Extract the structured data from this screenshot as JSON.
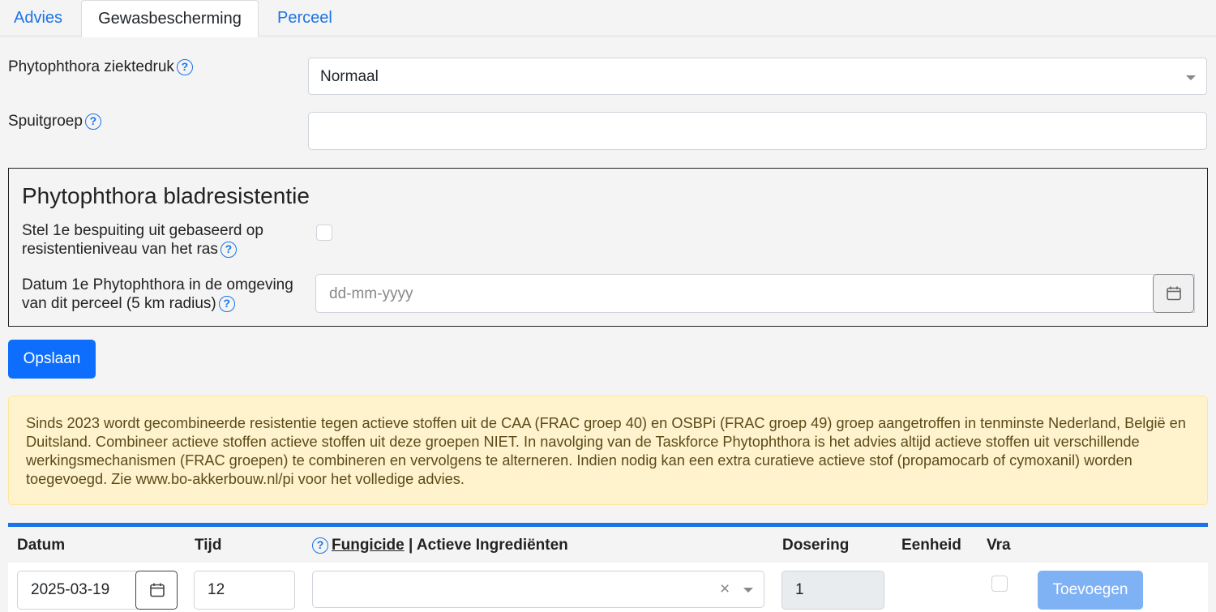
{
  "tabs": [
    {
      "label": "Advies"
    },
    {
      "label": "Gewasbescherming"
    },
    {
      "label": "Perceel"
    }
  ],
  "form": {
    "ziektedruk_label": "Phytophthora ziektedruk",
    "ziektedruk_value": "Normaal",
    "spuitgroep_label": "Spuitgroep",
    "spuitgroep_value": ""
  },
  "resistance": {
    "title": "Phytophthora bladresistentie",
    "checkbox_label_line1": "Stel 1e bespuiting uit gebaseerd op",
    "checkbox_label_line2": "resistentieniveau van het ras",
    "date_label_line1": "Datum 1e Phytophthora in de omgeving",
    "date_label_line2": "van dit perceel (5 km radius)",
    "date_placeholder": "dd-mm-yyyy"
  },
  "save_label": "Opslaan",
  "alert_text": "Sinds 2023 wordt gecombineerde resistentie tegen actieve stoffen uit de CAA (FRAC groep 40) en OSBPi (FRAC groep 49) groep aangetroffen in tenminste Nederland, België en Duitsland. Combineer actieve stoffen actieve stoffen uit deze groepen NIET. In navolging van de Taskforce Phytophthora is het advies altijd actieve stoffen uit verschillende werkingsmechanismen (FRAC groepen) te combineren en vervolgens te alterneren. Indien nodig kan een extra curatieve actieve stof (propamocarb of cymoxanil) worden toegevoegd. Zie www.bo-akkerbouw.nl/pi voor het volledige advies.",
  "table": {
    "headers": {
      "datum": "Datum",
      "tijd": "Tijd",
      "fungicide": "Fungicide",
      "separator": " | ",
      "ingredienten": "Actieve Ingrediënten",
      "dosering": "Dosering",
      "eenheid": "Eenheid",
      "vra": "Vra"
    },
    "row": {
      "datum": "2025-03-19",
      "tijd": "12",
      "fungicide": "",
      "clear": "×",
      "dosering": "1",
      "add_label": "Toevoegen"
    }
  },
  "icons": {
    "help": "?"
  },
  "colors": {
    "primary": "#0d6efd",
    "link": "#1a73e8",
    "alert_bg": "#fff3cd",
    "disabled_btn": "#7fb1f5"
  }
}
